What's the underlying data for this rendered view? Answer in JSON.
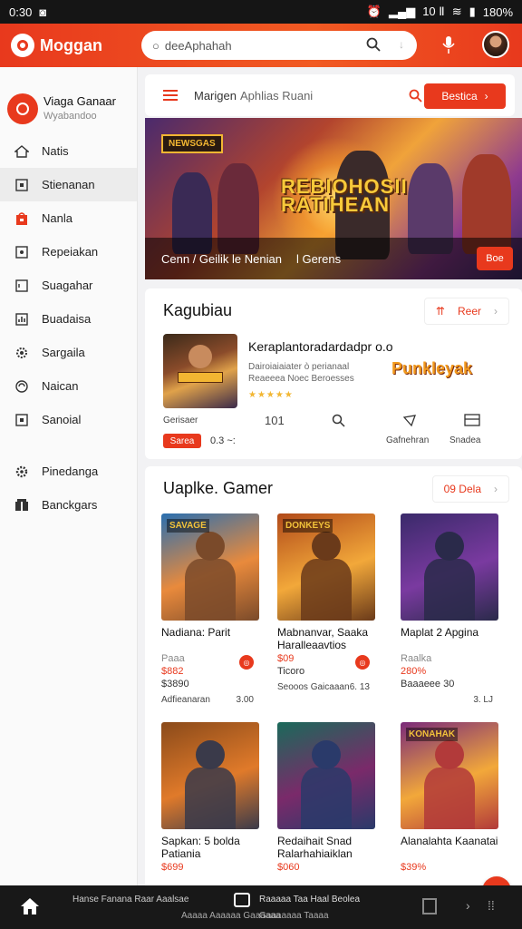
{
  "status": {
    "time": "0:30",
    "right": "10 Ⅱ",
    "battery": "180%"
  },
  "appbar": {
    "brand": "Moggan",
    "search_value": "deeAphahah"
  },
  "sidebar": {
    "user_name": "Viaga Ganaar",
    "user_sub": "Wyabandoo",
    "items": [
      {
        "label": "Natis",
        "icon": "house-icon"
      },
      {
        "label": "Stienanan",
        "icon": "square-icon"
      },
      {
        "label": "Nanla",
        "icon": "bag-icon"
      },
      {
        "label": "Repeiakan",
        "icon": "tag-icon"
      },
      {
        "label": "Suagahar",
        "icon": "file-icon"
      },
      {
        "label": "Buadaisa",
        "icon": "chart-icon"
      },
      {
        "label": "Sargaila",
        "icon": "settings-icon"
      },
      {
        "label": "Naican",
        "icon": "support-icon"
      },
      {
        "label": "Sanoial",
        "icon": "square-icon"
      },
      {
        "label": "Pinedanga",
        "icon": "gear-icon"
      },
      {
        "label": "Banckgars",
        "icon": "people-icon"
      }
    ]
  },
  "topbar": {
    "title": "Marigen",
    "subtitle": "Aphlias Ruani",
    "button": "Bestica"
  },
  "hero": {
    "tag": "NEWSGAS",
    "title_line1": "REBIOHOSII",
    "title_line2": "RATIHEAN",
    "caption": "Cenn / Geilik le Nenian",
    "caption2": "l Gerens",
    "button": "Boe"
  },
  "featured": {
    "heading": "Kagubiau",
    "pill": "Reer",
    "title": "Keraplantoradardadpr o.o",
    "desc": "Dairoiaiaiater ò perianaal Reaeeea Noec Beroesses",
    "stars": "★★★★★",
    "logo": "Punkleyak",
    "left_label": "Gerisaer",
    "count": "101",
    "act1_label": "Gafnehran",
    "act2_label": "Snadea",
    "badge": "Sarea",
    "version": "0.3 ~:"
  },
  "games": {
    "heading": "Uaplke. Gamer",
    "pill": "09 Dela",
    "items": [
      {
        "name": "Nadiana: Parit",
        "sub": "Paaa",
        "price": "$882",
        "price2": "$3890",
        "foot": "Adfieanaran",
        "foot2": "3.00",
        "art": "SAVAGE",
        "colors": [
          "#2a6fb0",
          "#e98a3c",
          "#7a4a2a"
        ]
      },
      {
        "name": "Mabnanvar, Saaka Haralleaavtios",
        "sub": "",
        "price": "$09",
        "price2": "Ticoro",
        "foot": "Seooos Gaicaaan",
        "foot2": "6. 13",
        "art": "DONKEYS",
        "colors": [
          "#b14a1a",
          "#f2a83a",
          "#6a3a1a"
        ]
      },
      {
        "name": "Maplat 2 Apgina",
        "sub": "Raalka",
        "price": "280%",
        "price2": "Baaaeee 30",
        "foot": "",
        "foot2": "3. LJ",
        "art": "",
        "colors": [
          "#3a2a6a",
          "#7a3aa0",
          "#2a2a4a"
        ]
      },
      {
        "name": "Sapkan: 5 bolda Patiania",
        "sub": "",
        "price": "$699",
        "price2": "",
        "foot": "",
        "foot2": "",
        "art": "",
        "colors": [
          "#8a4a1a",
          "#e07a2a",
          "#3a3a4a"
        ]
      },
      {
        "name": "Redaihait Snad Ralarhahiaiklan",
        "sub": "",
        "price": "$060",
        "price2": "",
        "foot": "",
        "foot2": "",
        "art": "",
        "colors": [
          "#1a6a5a",
          "#7a2a6a",
          "#2a3a6a"
        ]
      },
      {
        "name": "Alanalahta Kaanatai",
        "sub": "",
        "price": "$39%",
        "price2": "",
        "foot": "",
        "foot2": "",
        "art": "KONAHAK",
        "colors": [
          "#7a2a7a",
          "#f2a83a",
          "#b23a3a"
        ]
      }
    ]
  },
  "bottom": {
    "line1": "Hanse Fanana Raar Aaalsae",
    "line2": "Aaaaa Aaaaaa Gaaaaaa",
    "line3": "Raaaaa Taa Haal Beolea",
    "line4": "Gaaaaaaa Taaaa"
  }
}
